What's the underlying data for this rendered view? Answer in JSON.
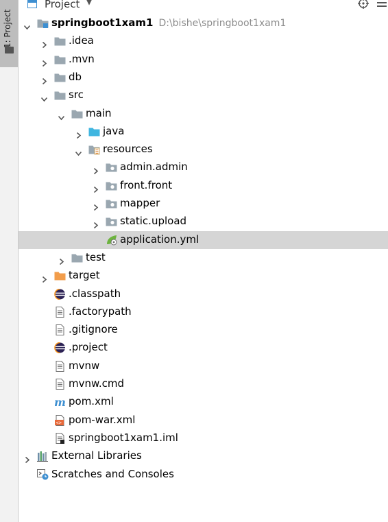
{
  "sidebar": {
    "tab_label": "1: Project"
  },
  "header": {
    "title": "Project"
  },
  "tree": [
    {
      "label": "springboot1xam1",
      "hint": "D:\\bishe\\springboot1xam1",
      "depth": 0,
      "arrow": "down",
      "icon": "module",
      "bold": true
    },
    {
      "label": ".idea",
      "depth": 1,
      "arrow": "right",
      "icon": "folder"
    },
    {
      "label": ".mvn",
      "depth": 1,
      "arrow": "right",
      "icon": "folder"
    },
    {
      "label": "db",
      "depth": 1,
      "arrow": "right",
      "icon": "folder"
    },
    {
      "label": "src",
      "depth": 1,
      "arrow": "down",
      "icon": "folder"
    },
    {
      "label": "main",
      "depth": 2,
      "arrow": "down",
      "icon": "folder"
    },
    {
      "label": "java",
      "depth": 3,
      "arrow": "right",
      "icon": "folder-source"
    },
    {
      "label": "resources",
      "depth": 3,
      "arrow": "down",
      "icon": "folder-resources"
    },
    {
      "label": "admin.admin",
      "depth": 4,
      "arrow": "right",
      "icon": "package"
    },
    {
      "label": "front.front",
      "depth": 4,
      "arrow": "right",
      "icon": "package"
    },
    {
      "label": "mapper",
      "depth": 4,
      "arrow": "right",
      "icon": "package"
    },
    {
      "label": "static.upload",
      "depth": 4,
      "arrow": "right",
      "icon": "package"
    },
    {
      "label": "application.yml",
      "depth": 4,
      "arrow": "none",
      "icon": "spring-yml",
      "selected": true
    },
    {
      "label": "test",
      "depth": 2,
      "arrow": "right",
      "icon": "folder"
    },
    {
      "label": "target",
      "depth": 1,
      "arrow": "right",
      "icon": "folder-excluded"
    },
    {
      "label": ".classpath",
      "depth": 1,
      "arrow": "none",
      "icon": "eclipse"
    },
    {
      "label": ".factorypath",
      "depth": 1,
      "arrow": "none",
      "icon": "text-file"
    },
    {
      "label": ".gitignore",
      "depth": 1,
      "arrow": "none",
      "icon": "text-file"
    },
    {
      "label": ".project",
      "depth": 1,
      "arrow": "none",
      "icon": "eclipse"
    },
    {
      "label": "mvnw",
      "depth": 1,
      "arrow": "none",
      "icon": "text-file"
    },
    {
      "label": "mvnw.cmd",
      "depth": 1,
      "arrow": "none",
      "icon": "text-file"
    },
    {
      "label": "pom.xml",
      "depth": 1,
      "arrow": "none",
      "icon": "maven"
    },
    {
      "label": "pom-war.xml",
      "depth": 1,
      "arrow": "none",
      "icon": "xml-file"
    },
    {
      "label": "springboot1xam1.iml",
      "depth": 1,
      "arrow": "none",
      "icon": "iml-file"
    },
    {
      "label": "External Libraries",
      "depth": 0,
      "arrow": "right",
      "icon": "libraries"
    },
    {
      "label": "Scratches and Consoles",
      "depth": 0,
      "arrow": "none",
      "icon": "scratches"
    }
  ],
  "colors": {
    "folder": "#9aa7b0",
    "folder_source": "#40b6e0",
    "folder_excluded": "#f29d4b",
    "selection": "#d5d5d5",
    "spring": "#6db33f",
    "maven": "#3d8fd1"
  }
}
